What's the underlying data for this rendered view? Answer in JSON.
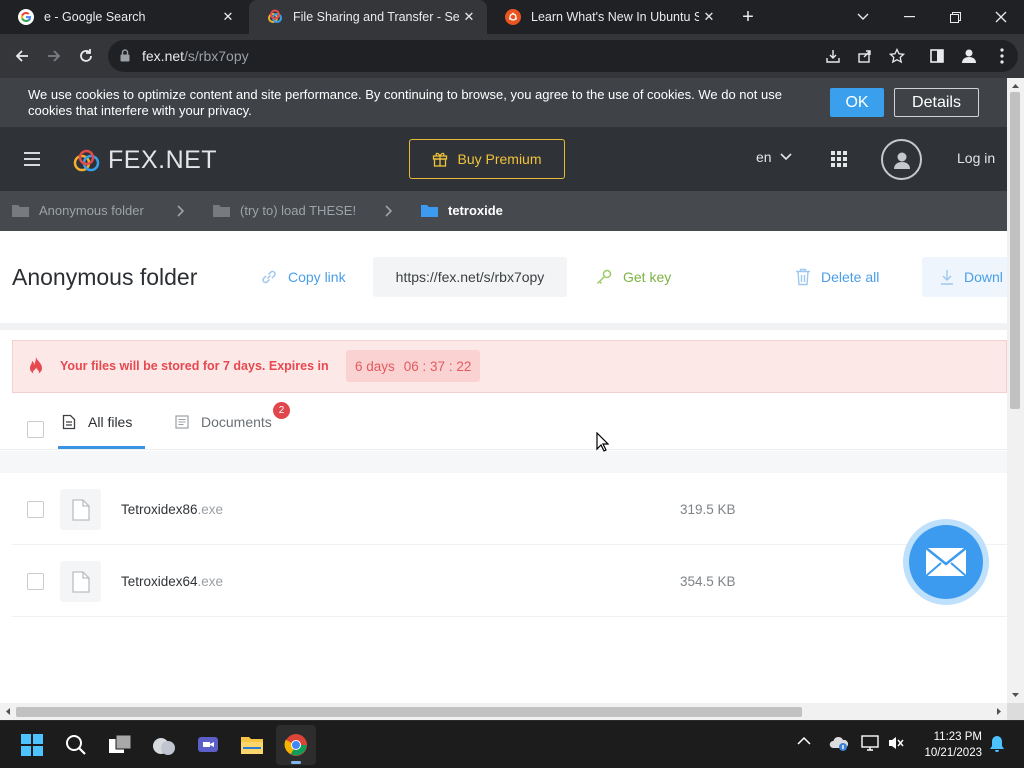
{
  "browser": {
    "tabs": [
      {
        "title": "e - Google Search",
        "active": false
      },
      {
        "title": "File Sharing and Transfer - Send l",
        "active": true
      },
      {
        "title": "Learn What's New In Ubuntu Ser",
        "active": false
      }
    ],
    "address": {
      "domain": "fex.net",
      "path": "/s/rbx7opy"
    }
  },
  "cookie_banner": {
    "text": "We use cookies to optimize content and site performance. By continuing to browse, you agree to the use of cookies. We do not use cookies that interfere with your privacy.",
    "ok_label": "OK",
    "details_label": "Details"
  },
  "site_header": {
    "logo_text": "FEX.NET",
    "buy_premium_label": "Buy Premium",
    "language": "en",
    "login_label": "Log in",
    "buy_color": "#f0c33b"
  },
  "breadcrumbs": [
    {
      "label": "Anonymous folder"
    },
    {
      "label": "(try to) load THESE!"
    },
    {
      "label": "tetroxide",
      "current": true
    }
  ],
  "folder": {
    "title": "Anonymous folder",
    "copy_link_label": "Copy link",
    "share_url": "https://fex.net/s/rbx7opy",
    "get_key_label": "Get key",
    "delete_all_label": "Delete all",
    "download_label": "Downl"
  },
  "expiry": {
    "message": "Your files will be stored for 7 days. Expires in",
    "days": "6 days",
    "time": "06 : 37 : 22",
    "accent_color": "#e6494f"
  },
  "file_tabs": {
    "items": [
      {
        "label": "All files",
        "active": true
      },
      {
        "label": "Documents",
        "badge": "2"
      }
    ]
  },
  "files": [
    {
      "name": "Tetroxidex86",
      "ext": ".exe",
      "size": "319.5 KB"
    },
    {
      "name": "Tetroxidex64",
      "ext": ".exe",
      "size": "354.5 KB"
    }
  ],
  "taskbar": {
    "clock_time": "11:23 PM",
    "clock_date": "10/21/2023"
  },
  "colors": {
    "accent_blue": "#3c9bee",
    "header_bg": "#2f3337"
  }
}
